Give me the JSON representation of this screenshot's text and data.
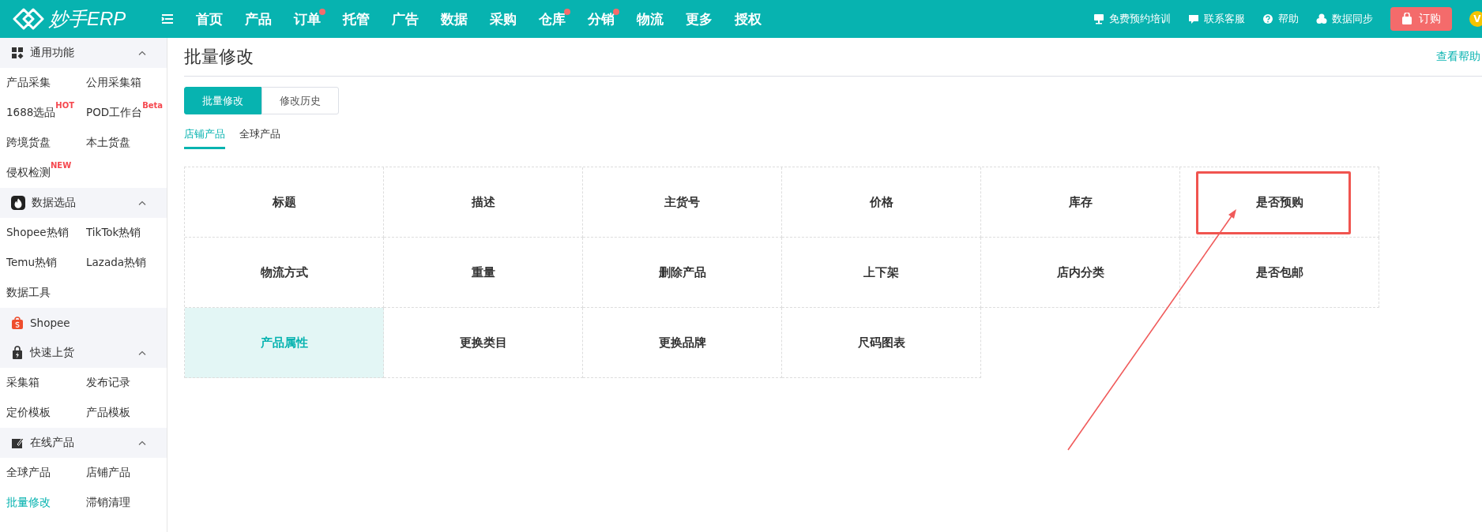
{
  "logo": {
    "text": "妙手ERP"
  },
  "nav": [
    {
      "label": "首页",
      "dot": false
    },
    {
      "label": "产品",
      "dot": false
    },
    {
      "label": "订单",
      "dot": true
    },
    {
      "label": "托管",
      "dot": false
    },
    {
      "label": "广告",
      "dot": false
    },
    {
      "label": "数据",
      "dot": false
    },
    {
      "label": "采购",
      "dot": false
    },
    {
      "label": "仓库",
      "dot": true
    },
    {
      "label": "分销",
      "dot": true
    },
    {
      "label": "物流",
      "dot": false
    },
    {
      "label": "更多",
      "dot": false
    },
    {
      "label": "授权",
      "dot": false
    }
  ],
  "top_links": [
    "免费预约培训",
    "联系客服",
    "帮助",
    "数据同步"
  ],
  "order_button": "订购",
  "avatar_badge": "V",
  "sidebar": [
    {
      "kind": "group",
      "label": "通用功能",
      "expanded": true,
      "items": [
        {
          "label": "产品采集",
          "selected": false
        },
        {
          "label": "公用采集箱",
          "selected": false
        },
        {
          "label": "1688选品",
          "badge": "HOT",
          "selected": false
        },
        {
          "label": "POD工作台",
          "badge": "Beta",
          "selected": false
        },
        {
          "label": "跨境货盘",
          "selected": false
        },
        {
          "label": "本土货盘",
          "selected": false
        },
        {
          "label": "侵权检测",
          "badge": "NEW",
          "selected": false
        }
      ]
    },
    {
      "kind": "group",
      "label": "数据选品",
      "expanded": true,
      "items": [
        {
          "label": "Shopee热销",
          "selected": false
        },
        {
          "label": "TikTok热销",
          "selected": false
        },
        {
          "label": "Temu热销",
          "selected": false
        },
        {
          "label": "Lazada热销",
          "selected": false
        },
        {
          "label": "数据工具",
          "selected": false
        }
      ]
    },
    {
      "kind": "link",
      "label": "Shopee"
    },
    {
      "kind": "group",
      "label": "快速上货",
      "expanded": true,
      "items": [
        {
          "label": "采集箱",
          "selected": false
        },
        {
          "label": "发布记录",
          "selected": false
        },
        {
          "label": "定价模板",
          "selected": false
        },
        {
          "label": "产品模板",
          "selected": false
        }
      ]
    },
    {
      "kind": "group",
      "label": "在线产品",
      "expanded": true,
      "items": [
        {
          "label": "全球产品",
          "selected": false
        },
        {
          "label": "店铺产品",
          "selected": false
        },
        {
          "label": "批量修改",
          "selected": true
        },
        {
          "label": "滞销清理",
          "selected": false
        }
      ]
    }
  ],
  "page": {
    "title": "批量修改",
    "help_link": "查看帮助",
    "tabs": [
      {
        "label": "批量修改",
        "selected": true
      },
      {
        "label": "修改历史",
        "selected": false
      }
    ],
    "subtabs": [
      {
        "label": "店铺产品",
        "selected": true
      },
      {
        "label": "全球产品",
        "selected": false
      }
    ],
    "cells": [
      {
        "label": "标题",
        "selected": false,
        "highlighted": false
      },
      {
        "label": "描述",
        "selected": false,
        "highlighted": false
      },
      {
        "label": "主货号",
        "selected": false,
        "highlighted": false
      },
      {
        "label": "价格",
        "selected": false,
        "highlighted": false
      },
      {
        "label": "库存",
        "selected": false,
        "highlighted": false
      },
      {
        "label": "是否预购",
        "selected": false,
        "highlighted": true
      },
      {
        "label": "物流方式",
        "selected": false,
        "highlighted": false
      },
      {
        "label": "重量",
        "selected": false,
        "highlighted": false
      },
      {
        "label": "删除产品",
        "selected": false,
        "highlighted": false
      },
      {
        "label": "上下架",
        "selected": false,
        "highlighted": false
      },
      {
        "label": "店内分类",
        "selected": false,
        "highlighted": false
      },
      {
        "label": "是否包邮",
        "selected": false,
        "highlighted": false
      },
      {
        "label": "产品属性",
        "selected": true,
        "highlighted": false
      },
      {
        "label": "更换类目",
        "selected": false,
        "highlighted": false
      },
      {
        "label": "更换品牌",
        "selected": false,
        "highlighted": false
      },
      {
        "label": "尺码图表",
        "selected": false,
        "highlighted": false
      }
    ]
  }
}
